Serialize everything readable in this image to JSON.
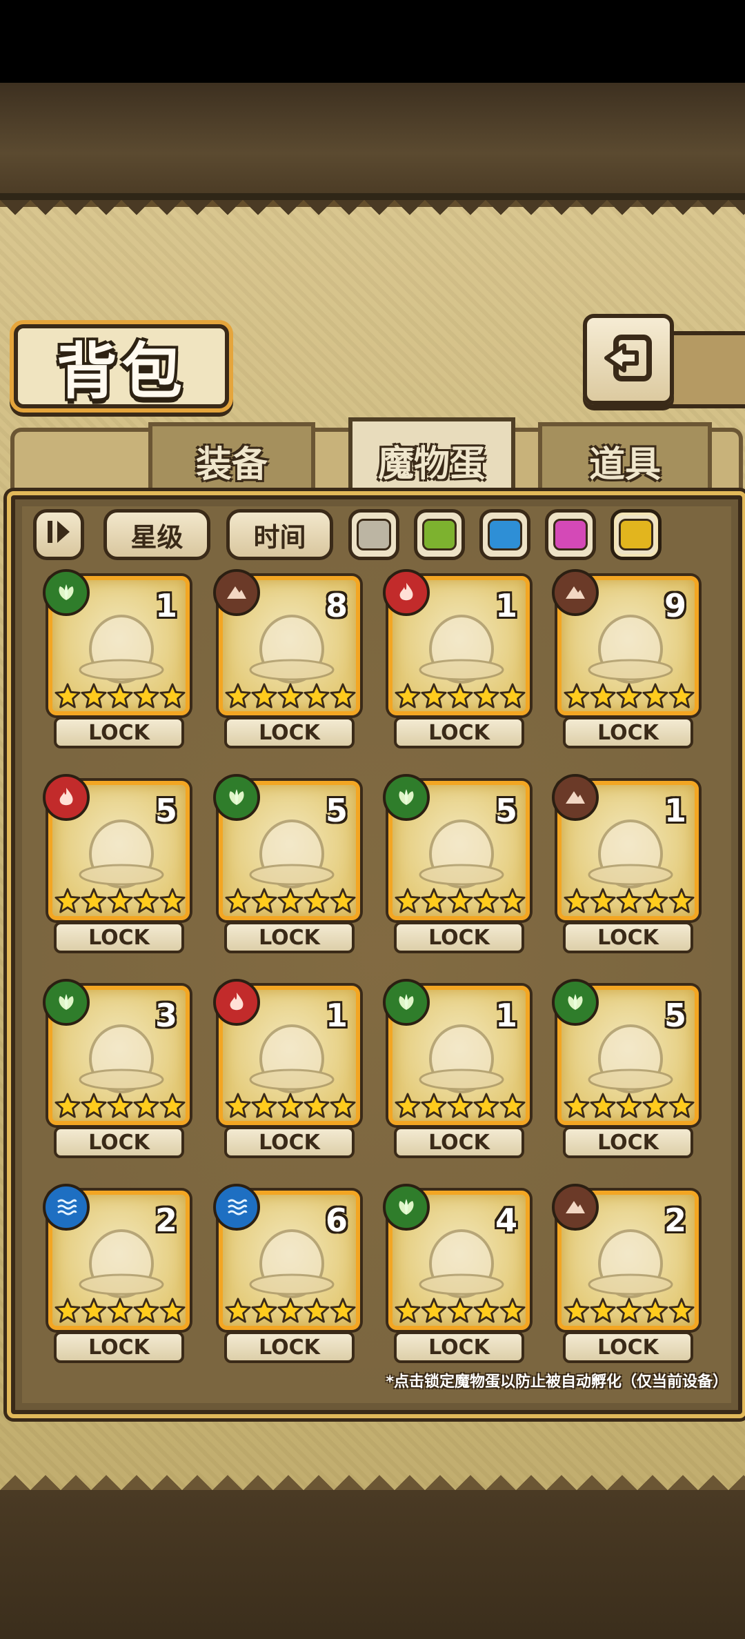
{
  "page": {
    "title": "背包"
  },
  "header": {
    "back_icon": "back-arrow-icon"
  },
  "tabs": [
    {
      "label": "装备",
      "active": false
    },
    {
      "label": "魔物蛋",
      "active": true
    },
    {
      "label": "道具",
      "active": false
    }
  ],
  "filters": {
    "sort_icon": "sort-toggle-icon",
    "sort_by_stars": "星级",
    "sort_by_time": "时间",
    "rarity_colors": [
      {
        "name": "gray",
        "color": "#bcb5a3",
        "selected": false
      },
      {
        "name": "green",
        "color": "#7db22f",
        "selected": false
      },
      {
        "name": "blue",
        "color": "#2e8fd6",
        "selected": false
      },
      {
        "name": "pink",
        "color": "#d449b7",
        "selected": false
      },
      {
        "name": "gold",
        "color": "#e2b51e",
        "selected": true
      }
    ]
  },
  "eggs": [
    {
      "element": "nature",
      "count": "1",
      "stars": 5,
      "lock": "LOCK"
    },
    {
      "element": "earth",
      "count": "8",
      "stars": 5,
      "lock": "LOCK"
    },
    {
      "element": "fire",
      "count": "1",
      "stars": 5,
      "lock": "LOCK"
    },
    {
      "element": "earth",
      "count": "9",
      "stars": 5,
      "lock": "LOCK"
    },
    {
      "element": "fire",
      "count": "5",
      "stars": 5,
      "lock": "LOCK"
    },
    {
      "element": "nature",
      "count": "5",
      "stars": 5,
      "lock": "LOCK"
    },
    {
      "element": "nature",
      "count": "5",
      "stars": 5,
      "lock": "LOCK"
    },
    {
      "element": "earth",
      "count": "1",
      "stars": 5,
      "lock": "LOCK"
    },
    {
      "element": "nature",
      "count": "3",
      "stars": 5,
      "lock": "LOCK"
    },
    {
      "element": "fire",
      "count": "1",
      "stars": 5,
      "lock": "LOCK"
    },
    {
      "element": "nature",
      "count": "1",
      "stars": 5,
      "lock": "LOCK"
    },
    {
      "element": "nature",
      "count": "5",
      "stars": 5,
      "lock": "LOCK"
    },
    {
      "element": "water",
      "count": "2",
      "stars": 5,
      "lock": "LOCK"
    },
    {
      "element": "water",
      "count": "6",
      "stars": 5,
      "lock": "LOCK"
    },
    {
      "element": "nature",
      "count": "4",
      "stars": 5,
      "lock": "LOCK"
    },
    {
      "element": "earth",
      "count": "2",
      "stars": 5,
      "lock": "LOCK"
    }
  ],
  "footer_note": "*点击锁定魔物蛋以防止被自动孵化（仅当前设备）"
}
